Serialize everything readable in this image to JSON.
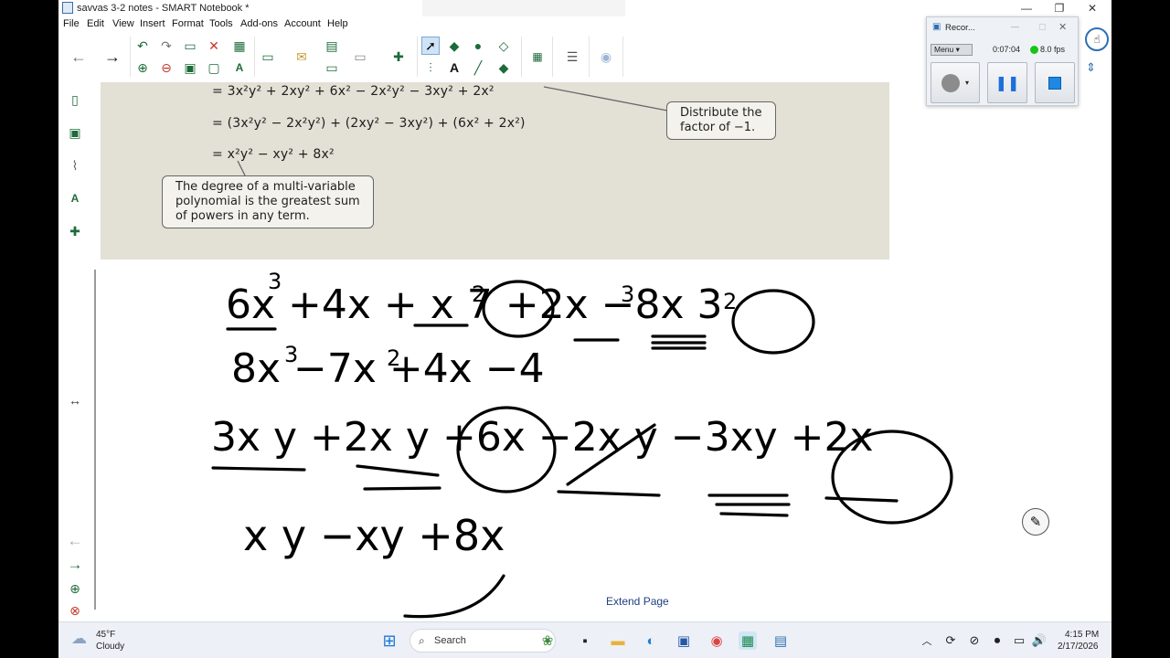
{
  "window": {
    "title": "savvas 3-2 notes - SMART Notebook *",
    "controls": {
      "minimize": "—",
      "restore": "❐",
      "close": "✕"
    }
  },
  "menu": [
    "File",
    "Edit",
    "View",
    "Insert",
    "Format",
    "Tools",
    "Add-ons",
    "Account",
    "Help"
  ],
  "toolbar": {
    "icons": [
      "back-arrow-icon",
      "forward-arrow-icon",
      "undo-icon",
      "redo-icon",
      "new-page-icon",
      "delete-icon",
      "table-icon",
      "screen-shade-icon",
      "capture-icon",
      "properties-icon",
      "select-icon",
      "shapes-icon",
      "fill-icon",
      "pen-icon",
      "text-icon",
      "eraser-icon",
      "colors-icon",
      "line-style-icon",
      "effects-icon"
    ]
  },
  "sidebar": {
    "icons": [
      "page-sorter-icon",
      "gallery-icon",
      "attachments-icon",
      "properties-icon",
      "add-ons-icon"
    ],
    "collapse_glyph": "↔",
    "nav_glyphs": [
      "←",
      "→"
    ]
  },
  "scan": {
    "line1": "= 3x²y² + 2xy² + 6x² − 2x²y² − 3xy² + 2x²",
    "line2": "= (3x²y² − 2x²y²) + (2xy² − 3xy²) + (6x² + 2x²)",
    "line3": "= x²y² − xy² + 8x²",
    "callout_distribute": [
      "Distribute the",
      "factor of −1."
    ],
    "callout_degree": [
      "The degree of a multi-variable",
      "polynomial is the greatest sum",
      "of powers in any term."
    ]
  },
  "canvas": {
    "extend_page_label": "Extend Page"
  },
  "recorder": {
    "title": "Recor...",
    "menu_label": "Menu",
    "elapsed": "0:07:04",
    "fps": "8.0 fps",
    "colors": {
      "live_indicator": "#18c418",
      "stop": "#1e88e5"
    }
  },
  "taskbar": {
    "weather_temp": "45°F",
    "weather_desc": "Cloudy",
    "search_placeholder": "Search",
    "time": "4:15 PM",
    "date": "2/17/2026"
  },
  "colors": {
    "ink": "#000000",
    "link": "#1f3f80",
    "scan_bg": "#e3e0d6"
  }
}
